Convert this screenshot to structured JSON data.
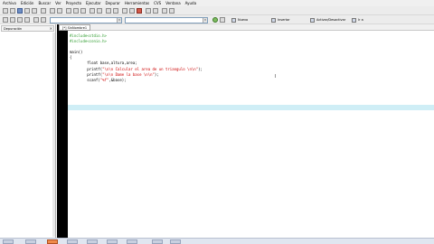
{
  "menubar": {
    "items": [
      "Archivo",
      "Edición",
      "Buscar",
      "Ver",
      "Proyecto",
      "Ejecutar",
      "Depurar",
      "Herramientas",
      "CVS",
      "Ventana",
      "Ayuda"
    ]
  },
  "toolbar": {
    "nuevo_label": "Nuevo",
    "insertar_label": "Insertar",
    "activar_label": "Activar/Desactivar",
    "ir_label": "Ir a"
  },
  "left_panel": {
    "tab_label": "Depuración",
    "close_glyph": "✕"
  },
  "editor": {
    "file_tab": "[*] SinNombre1",
    "cursor_glyph": "I",
    "code_lines": [
      {
        "kind": "inc",
        "text": "#include<stdio.h>"
      },
      {
        "kind": "inc",
        "text": "#include<conio.h>"
      },
      {
        "kind": "plain",
        "text": ""
      },
      {
        "kind": "plain",
        "text": "main()"
      },
      {
        "kind": "plain",
        "text": "{"
      },
      {
        "kind": "plain",
        "text": "        float base,altura,area;"
      },
      {
        "kind": "mixed",
        "pre": "        printf(",
        "str": "\"\\n\\n Calcular el area de un triangulo \\n\\n\"",
        "post": ");"
      },
      {
        "kind": "mixed",
        "pre": "        printf(",
        "str": "\"\\n\\n Dame la base \\n\\n\"",
        "post": ");"
      },
      {
        "kind": "mixed",
        "pre": "        scanf(",
        "str": "\"%f\"",
        "post": ",&base);"
      }
    ]
  },
  "status": {
    "clock": ""
  },
  "colors": {
    "gutter": "#000000",
    "line_highlight": "#cfeef6",
    "include_green": "#2a9a2a",
    "string_red": "#cc0000"
  }
}
